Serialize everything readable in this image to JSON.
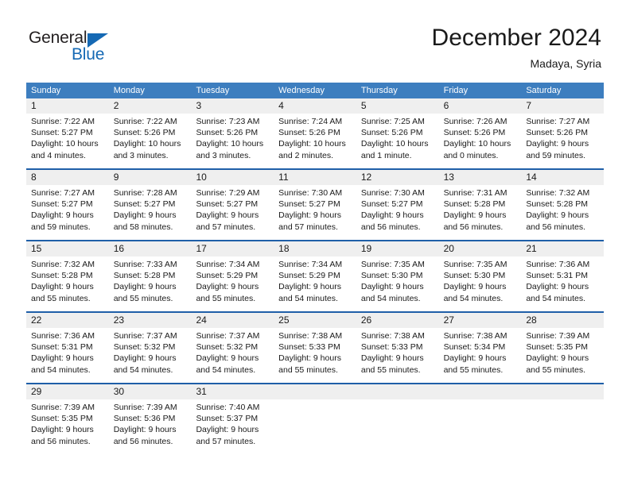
{
  "logo": {
    "word_one": "General",
    "word_two": "Blue",
    "triangle_icon": "triangle-icon",
    "brand_color": "#1569b4",
    "text_color": "#231f20"
  },
  "header": {
    "title": "December 2024",
    "subtitle": "Madaya, Syria"
  },
  "calendar": {
    "header_bg": "#3d7ebf",
    "row_divider_color": "#1f5fa8",
    "day_band_bg": "#efefef",
    "weekdays": [
      "Sunday",
      "Monday",
      "Tuesday",
      "Wednesday",
      "Thursday",
      "Friday",
      "Saturday"
    ],
    "weeks": [
      [
        {
          "day": "1",
          "sunrise": "Sunrise: 7:22 AM",
          "sunset": "Sunset: 5:27 PM",
          "daylight_1": "Daylight: 10 hours",
          "daylight_2": "and 4 minutes."
        },
        {
          "day": "2",
          "sunrise": "Sunrise: 7:22 AM",
          "sunset": "Sunset: 5:26 PM",
          "daylight_1": "Daylight: 10 hours",
          "daylight_2": "and 3 minutes."
        },
        {
          "day": "3",
          "sunrise": "Sunrise: 7:23 AM",
          "sunset": "Sunset: 5:26 PM",
          "daylight_1": "Daylight: 10 hours",
          "daylight_2": "and 3 minutes."
        },
        {
          "day": "4",
          "sunrise": "Sunrise: 7:24 AM",
          "sunset": "Sunset: 5:26 PM",
          "daylight_1": "Daylight: 10 hours",
          "daylight_2": "and 2 minutes."
        },
        {
          "day": "5",
          "sunrise": "Sunrise: 7:25 AM",
          "sunset": "Sunset: 5:26 PM",
          "daylight_1": "Daylight: 10 hours",
          "daylight_2": "and 1 minute."
        },
        {
          "day": "6",
          "sunrise": "Sunrise: 7:26 AM",
          "sunset": "Sunset: 5:26 PM",
          "daylight_1": "Daylight: 10 hours",
          "daylight_2": "and 0 minutes."
        },
        {
          "day": "7",
          "sunrise": "Sunrise: 7:27 AM",
          "sunset": "Sunset: 5:26 PM",
          "daylight_1": "Daylight: 9 hours",
          "daylight_2": "and 59 minutes."
        }
      ],
      [
        {
          "day": "8",
          "sunrise": "Sunrise: 7:27 AM",
          "sunset": "Sunset: 5:27 PM",
          "daylight_1": "Daylight: 9 hours",
          "daylight_2": "and 59 minutes."
        },
        {
          "day": "9",
          "sunrise": "Sunrise: 7:28 AM",
          "sunset": "Sunset: 5:27 PM",
          "daylight_1": "Daylight: 9 hours",
          "daylight_2": "and 58 minutes."
        },
        {
          "day": "10",
          "sunrise": "Sunrise: 7:29 AM",
          "sunset": "Sunset: 5:27 PM",
          "daylight_1": "Daylight: 9 hours",
          "daylight_2": "and 57 minutes."
        },
        {
          "day": "11",
          "sunrise": "Sunrise: 7:30 AM",
          "sunset": "Sunset: 5:27 PM",
          "daylight_1": "Daylight: 9 hours",
          "daylight_2": "and 57 minutes."
        },
        {
          "day": "12",
          "sunrise": "Sunrise: 7:30 AM",
          "sunset": "Sunset: 5:27 PM",
          "daylight_1": "Daylight: 9 hours",
          "daylight_2": "and 56 minutes."
        },
        {
          "day": "13",
          "sunrise": "Sunrise: 7:31 AM",
          "sunset": "Sunset: 5:28 PM",
          "daylight_1": "Daylight: 9 hours",
          "daylight_2": "and 56 minutes."
        },
        {
          "day": "14",
          "sunrise": "Sunrise: 7:32 AM",
          "sunset": "Sunset: 5:28 PM",
          "daylight_1": "Daylight: 9 hours",
          "daylight_2": "and 56 minutes."
        }
      ],
      [
        {
          "day": "15",
          "sunrise": "Sunrise: 7:32 AM",
          "sunset": "Sunset: 5:28 PM",
          "daylight_1": "Daylight: 9 hours",
          "daylight_2": "and 55 minutes."
        },
        {
          "day": "16",
          "sunrise": "Sunrise: 7:33 AM",
          "sunset": "Sunset: 5:28 PM",
          "daylight_1": "Daylight: 9 hours",
          "daylight_2": "and 55 minutes."
        },
        {
          "day": "17",
          "sunrise": "Sunrise: 7:34 AM",
          "sunset": "Sunset: 5:29 PM",
          "daylight_1": "Daylight: 9 hours",
          "daylight_2": "and 55 minutes."
        },
        {
          "day": "18",
          "sunrise": "Sunrise: 7:34 AM",
          "sunset": "Sunset: 5:29 PM",
          "daylight_1": "Daylight: 9 hours",
          "daylight_2": "and 54 minutes."
        },
        {
          "day": "19",
          "sunrise": "Sunrise: 7:35 AM",
          "sunset": "Sunset: 5:30 PM",
          "daylight_1": "Daylight: 9 hours",
          "daylight_2": "and 54 minutes."
        },
        {
          "day": "20",
          "sunrise": "Sunrise: 7:35 AM",
          "sunset": "Sunset: 5:30 PM",
          "daylight_1": "Daylight: 9 hours",
          "daylight_2": "and 54 minutes."
        },
        {
          "day": "21",
          "sunrise": "Sunrise: 7:36 AM",
          "sunset": "Sunset: 5:31 PM",
          "daylight_1": "Daylight: 9 hours",
          "daylight_2": "and 54 minutes."
        }
      ],
      [
        {
          "day": "22",
          "sunrise": "Sunrise: 7:36 AM",
          "sunset": "Sunset: 5:31 PM",
          "daylight_1": "Daylight: 9 hours",
          "daylight_2": "and 54 minutes."
        },
        {
          "day": "23",
          "sunrise": "Sunrise: 7:37 AM",
          "sunset": "Sunset: 5:32 PM",
          "daylight_1": "Daylight: 9 hours",
          "daylight_2": "and 54 minutes."
        },
        {
          "day": "24",
          "sunrise": "Sunrise: 7:37 AM",
          "sunset": "Sunset: 5:32 PM",
          "daylight_1": "Daylight: 9 hours",
          "daylight_2": "and 54 minutes."
        },
        {
          "day": "25",
          "sunrise": "Sunrise: 7:38 AM",
          "sunset": "Sunset: 5:33 PM",
          "daylight_1": "Daylight: 9 hours",
          "daylight_2": "and 55 minutes."
        },
        {
          "day": "26",
          "sunrise": "Sunrise: 7:38 AM",
          "sunset": "Sunset: 5:33 PM",
          "daylight_1": "Daylight: 9 hours",
          "daylight_2": "and 55 minutes."
        },
        {
          "day": "27",
          "sunrise": "Sunrise: 7:38 AM",
          "sunset": "Sunset: 5:34 PM",
          "daylight_1": "Daylight: 9 hours",
          "daylight_2": "and 55 minutes."
        },
        {
          "day": "28",
          "sunrise": "Sunrise: 7:39 AM",
          "sunset": "Sunset: 5:35 PM",
          "daylight_1": "Daylight: 9 hours",
          "daylight_2": "and 55 minutes."
        }
      ],
      [
        {
          "day": "29",
          "sunrise": "Sunrise: 7:39 AM",
          "sunset": "Sunset: 5:35 PM",
          "daylight_1": "Daylight: 9 hours",
          "daylight_2": "and 56 minutes."
        },
        {
          "day": "30",
          "sunrise": "Sunrise: 7:39 AM",
          "sunset": "Sunset: 5:36 PM",
          "daylight_1": "Daylight: 9 hours",
          "daylight_2": "and 56 minutes."
        },
        {
          "day": "31",
          "sunrise": "Sunrise: 7:40 AM",
          "sunset": "Sunset: 5:37 PM",
          "daylight_1": "Daylight: 9 hours",
          "daylight_2": "and 57 minutes."
        },
        {
          "day": "",
          "sunrise": "",
          "sunset": "",
          "daylight_1": "",
          "daylight_2": ""
        },
        {
          "day": "",
          "sunrise": "",
          "sunset": "",
          "daylight_1": "",
          "daylight_2": ""
        },
        {
          "day": "",
          "sunrise": "",
          "sunset": "",
          "daylight_1": "",
          "daylight_2": ""
        },
        {
          "day": "",
          "sunrise": "",
          "sunset": "",
          "daylight_1": "",
          "daylight_2": ""
        }
      ]
    ]
  }
}
